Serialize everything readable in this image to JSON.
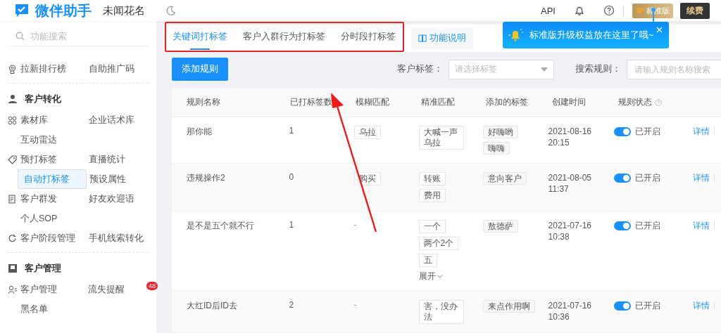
{
  "header": {
    "logo": "微伴助手",
    "account": "未闻花名",
    "links": [
      "API"
    ],
    "plan_badge": "标准版",
    "renew": "续费"
  },
  "tooltip": {
    "text": "标准版升级权益放在这里了哦~"
  },
  "sidebar": {
    "search": {
      "placeholder": "功能搜索"
    },
    "sections": [
      {
        "rows": [
          [
            {
              "label": "拉新排行榜",
              "icon": true,
              "selected": false
            },
            {
              "label": "自助推广码",
              "selected": false
            }
          ]
        ]
      },
      {
        "title": "客户转化",
        "rows": [
          [
            {
              "label": "素材库",
              "icon": true,
              "selected": false
            },
            {
              "label": "企业话术库",
              "selected": false
            }
          ],
          [
            {
              "label": "互动雷达",
              "selected": false
            }
          ],
          [
            {
              "label": "预打标签",
              "icon": true,
              "selected": false
            },
            {
              "label": "直播统计",
              "selected": false
            }
          ],
          [
            {
              "label": "自动打标签",
              "selected": true
            },
            {
              "label": "预设属性",
              "selected": false
            }
          ],
          [
            {
              "label": "客户群发",
              "icon": true,
              "selected": false
            },
            {
              "label": "好友欢迎语",
              "selected": false
            }
          ],
          [
            {
              "label": "个人SOP",
              "selected": false
            }
          ],
          [
            {
              "label": "客户阶段管理",
              "icon": true,
              "selected": false
            },
            {
              "label": "手机线索转化",
              "selected": false
            }
          ]
        ]
      },
      {
        "title": "客户管理",
        "rows": [
          [
            {
              "label": "客户管理",
              "icon": true,
              "selected": false
            },
            {
              "label": "流失提醒",
              "selected": false,
              "badge": "48"
            }
          ],
          [
            {
              "label": "黑名单",
              "selected": false
            }
          ]
        ]
      }
    ]
  },
  "tabs": [
    {
      "label": "关键词打标签",
      "selected": true
    },
    {
      "label": "客户入群行为打标签",
      "selected": false
    },
    {
      "label": "分时段打标签",
      "selected": false
    }
  ],
  "help_link": "功能说明",
  "toolbar": {
    "add_button": "添加规则",
    "filters": [
      {
        "label": "客户标签：",
        "kind": "select",
        "placeholder": "请选择标签"
      },
      {
        "label": "搜索规则：",
        "kind": "input",
        "placeholder": "请输入规则名称搜索"
      }
    ]
  },
  "table": {
    "columns": [
      "规则名称",
      "已打标签数",
      "模糊匹配",
      "精准匹配",
      "添加的标签",
      "创建时间",
      "规则状态"
    ],
    "rows": [
      {
        "name": "那你能",
        "count": "1",
        "fuzzy": [
          "乌拉"
        ],
        "precise": [
          "大喊一声乌拉"
        ],
        "tags": [
          "好嗨哟",
          "嗨嗨"
        ],
        "created": "2021-08-16 20:15",
        "status": {
          "on": true,
          "label": "已开启"
        },
        "action": "详情"
      },
      {
        "name": "违规操作2",
        "count": "0",
        "fuzzy": [
          "购买"
        ],
        "precise": [
          "转账",
          "费用"
        ],
        "tags": [
          "意向客户"
        ],
        "created": "2021-08-05 11:37",
        "status": {
          "on": true,
          "label": "已开启"
        },
        "action": "详情"
      },
      {
        "name": "是不是五个就不行",
        "count": "1",
        "fuzzy": "-",
        "precise": [
          "一个",
          "两个2个",
          "五"
        ],
        "expand": "展开",
        "tags": [
          "敖德萨"
        ],
        "created": "2021-07-16 10:38",
        "status": {
          "on": true,
          "label": "已开启"
        },
        "action": "详情"
      },
      {
        "name": "大红ID后ID去",
        "count": "2",
        "fuzzy": "-",
        "precise": [
          "害，没办法"
        ],
        "tags": [
          "来点作用啊"
        ],
        "created": "2021-07-16 10:36",
        "status": {
          "on": true,
          "label": "已开启"
        },
        "action": "详情"
      }
    ]
  }
}
